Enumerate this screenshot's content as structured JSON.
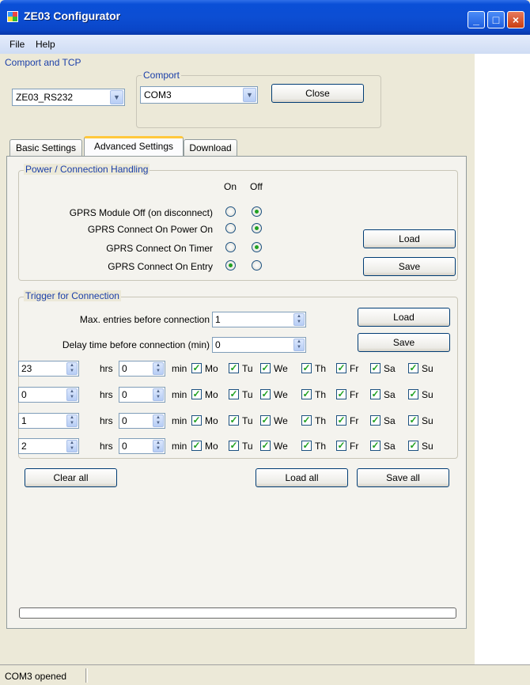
{
  "window": {
    "title": "ZE03 Configurator"
  },
  "menu": [
    "File",
    "Help"
  ],
  "comport_tcp": {
    "group_label": "Comport and TCP",
    "device_select": "ZE03_RS232",
    "comport_group_label": "Comport",
    "comport_select": "COM3",
    "close_label": "Close"
  },
  "tabs": [
    "Basic Settings",
    "Advanced Settings",
    "Download"
  ],
  "power": {
    "group_label": "Power / Connection Handling",
    "col_on": "On",
    "col_off": "Off",
    "rows": [
      {
        "label": "GPRS Module Off (on disconnect)",
        "selected": "off"
      },
      {
        "label": "GPRS Connect On Power On",
        "selected": "off"
      },
      {
        "label": "GPRS Connect On Timer",
        "selected": "off"
      },
      {
        "label": "GPRS Connect On Entry",
        "selected": "on"
      }
    ],
    "load_label": "Load",
    "save_label": "Save"
  },
  "trigger": {
    "group_label": "Trigger for Connection",
    "max_entries_label": "Max. entries before connection",
    "max_entries_value": "1",
    "delay_label": "Delay time before connection (min)",
    "delay_value": "0",
    "load_label": "Load",
    "save_label": "Save",
    "hrs_label": "hrs",
    "min_label": "min",
    "days": [
      "Mo",
      "Tu",
      "We",
      "Th",
      "Fr",
      "Sa",
      "Su"
    ],
    "schedules": [
      {
        "hrs": "23",
        "min": "0"
      },
      {
        "hrs": "0",
        "min": "0"
      },
      {
        "hrs": "1",
        "min": "0"
      },
      {
        "hrs": "2",
        "min": "0"
      }
    ]
  },
  "buttons": {
    "clear_all": "Clear all",
    "load_all": "Load all",
    "save_all": "Save all"
  },
  "progress": {
    "value": 0
  },
  "status": {
    "text": "COM3 opened"
  }
}
